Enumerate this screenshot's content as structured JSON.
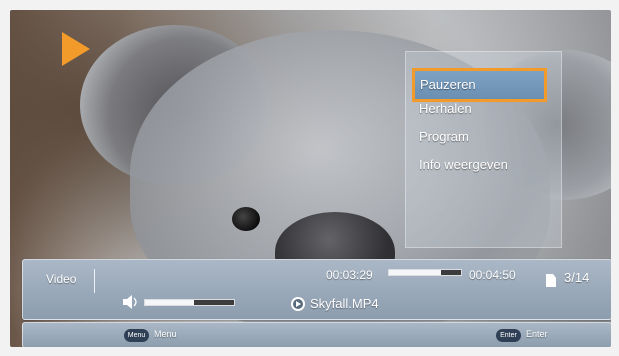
{
  "menu": {
    "items": [
      {
        "label": "Pauzeren",
        "selected": true
      },
      {
        "label": "Herhalen",
        "selected": false
      },
      {
        "label": "Program",
        "selected": false
      },
      {
        "label": "Info weergeven",
        "selected": false
      }
    ]
  },
  "info": {
    "category": "Video",
    "elapsed": "00:03:29",
    "duration": "00:04:50",
    "playback_progress": 0.72,
    "file_counter": "3/14",
    "volume_level": 0.55,
    "filename": "Skyfall.MP4"
  },
  "footer": {
    "menu_key": "Menu",
    "menu_label": "Menu",
    "enter_key": "Enter",
    "enter_label": "Enter"
  },
  "colors": {
    "accent": "#f39b2a",
    "bar": "#9eaebe",
    "pill": "#2f3f55"
  },
  "icons": [
    "play-icon",
    "speaker-icon",
    "file-icon",
    "disc-icon"
  ]
}
